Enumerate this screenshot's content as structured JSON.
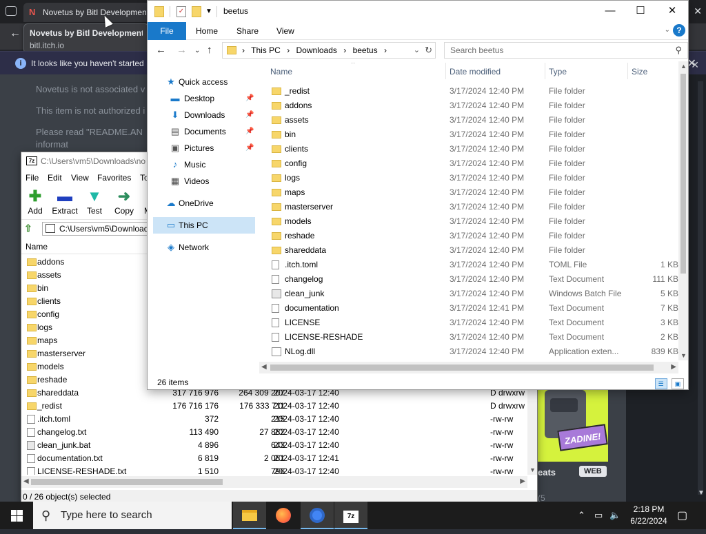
{
  "browser": {
    "tab_title": "Novetus by Bitl Development",
    "tab_favicon": "N",
    "tooltip_title": "Novetus by Bitl Development St",
    "tooltip_url": "bitl.itch.io",
    "info_text": "It looks like you haven't started I",
    "paragraphs": [
      "Novetus is not associated v",
      "This item is not authorized i",
      "Please read \"README.AN",
      "informat"
    ],
    "game_title": "eats",
    "web_badge": "WEB",
    "game_logo": "ZADINE!",
    "frag": "(5"
  },
  "sevenzip": {
    "title": "C:\\Users\\vm5\\Downloads\\no",
    "app_icon": "7z",
    "menu": [
      "File",
      "Edit",
      "View",
      "Favorites",
      "To"
    ],
    "tools": [
      {
        "label": "Add",
        "glyph": "✚",
        "color": "#2e9e2e"
      },
      {
        "label": "Extract",
        "glyph": "▬",
        "color": "#1f3fbf"
      },
      {
        "label": "Test",
        "glyph": "▼",
        "color": "#1fb8a6"
      },
      {
        "label": "Copy",
        "glyph": "➜",
        "color": "#2e8e5e"
      },
      {
        "label": "M",
        "glyph": "",
        "color": "#000"
      }
    ],
    "path": "C:\\Users\\vm5\\Download",
    "col_name": "Name",
    "rows": [
      {
        "name": "addons",
        "type": "folder",
        "size": "",
        "packed": "",
        "modified": "",
        "attr": ""
      },
      {
        "name": "assets",
        "type": "folder",
        "size": "",
        "packed": "",
        "modified": "",
        "attr": ""
      },
      {
        "name": "bin",
        "type": "folder",
        "size": "",
        "packed": "",
        "modified": "",
        "attr": ""
      },
      {
        "name": "clients",
        "type": "folder",
        "size": "",
        "packed": "",
        "modified": "",
        "attr": ""
      },
      {
        "name": "config",
        "type": "folder",
        "size": "",
        "packed": "",
        "modified": "",
        "attr": ""
      },
      {
        "name": "logs",
        "type": "folder",
        "size": "",
        "packed": "",
        "modified": "",
        "attr": ""
      },
      {
        "name": "maps",
        "type": "folder",
        "size": "",
        "packed": "",
        "modified": "",
        "attr": ""
      },
      {
        "name": "masterserver",
        "type": "folder",
        "size": "",
        "packed": "",
        "modified": "",
        "attr": ""
      },
      {
        "name": "models",
        "type": "folder",
        "size": "",
        "packed": "",
        "modified": "",
        "attr": ""
      },
      {
        "name": "reshade",
        "type": "folder",
        "size": "",
        "packed": "",
        "modified": "",
        "attr": ""
      },
      {
        "name": "shareddata",
        "type": "folder",
        "size": "317 716 976",
        "packed": "264 309 207",
        "modified": "2024-03-17 12:40",
        "attr": "D drwxrw"
      },
      {
        "name": "_redist",
        "type": "folder",
        "size": "176 716 176",
        "packed": "176 333 711",
        "modified": "2024-03-17 12:40",
        "attr": "D drwxrw"
      },
      {
        "name": ".itch.toml",
        "type": "file",
        "size": "372",
        "packed": "215",
        "modified": "2024-03-17 12:40",
        "attr": "-rw-rw"
      },
      {
        "name": "changelog.txt",
        "type": "file",
        "size": "113 490",
        "packed": "27 882",
        "modified": "2024-03-17 12:40",
        "attr": "-rw-rw"
      },
      {
        "name": "clean_junk.bat",
        "type": "bat",
        "size": "4 896",
        "packed": "643",
        "modified": "2024-03-17 12:40",
        "attr": "-rw-rw"
      },
      {
        "name": "documentation.txt",
        "type": "file",
        "size": "6 819",
        "packed": "2 081",
        "modified": "2024-03-17 12:41",
        "attr": "-rw-rw"
      },
      {
        "name": "LICENSE-RESHADE.txt",
        "type": "file",
        "size": "1 510",
        "packed": "796",
        "modified": "2024-03-17 12:40",
        "attr": "-rw-rw"
      }
    ],
    "status": "0 / 26 object(s) selected"
  },
  "explorer": {
    "title": "beetus",
    "ribbon_file": "File",
    "ribbon_tabs": [
      "Home",
      "Share",
      "View"
    ],
    "help": "?",
    "crumbs": [
      "This PC",
      "Downloads",
      "beetus"
    ],
    "search_placeholder": "Search beetus",
    "nav": [
      {
        "label": "Quick access",
        "icon": "★",
        "icon_color": "#1979ca",
        "pinned": false,
        "indent": 0,
        "selected": false
      },
      {
        "label": "Desktop",
        "icon": "▬",
        "icon_color": "#1979ca",
        "pinned": true,
        "indent": 1,
        "selected": false
      },
      {
        "label": "Downloads",
        "icon": "⬇",
        "icon_color": "#1979ca",
        "pinned": true,
        "indent": 1,
        "selected": false
      },
      {
        "label": "Documents",
        "icon": "▤",
        "icon_color": "#555",
        "pinned": true,
        "indent": 1,
        "selected": false
      },
      {
        "label": "Pictures",
        "icon": "▣",
        "icon_color": "#555",
        "pinned": true,
        "indent": 1,
        "selected": false
      },
      {
        "label": "Music",
        "icon": "♪",
        "icon_color": "#1979ca",
        "pinned": false,
        "indent": 1,
        "selected": false
      },
      {
        "label": "Videos",
        "icon": "▦",
        "icon_color": "#444",
        "pinned": false,
        "indent": 1,
        "selected": false
      },
      {
        "label": "OneDrive",
        "icon": "☁",
        "icon_color": "#1979ca",
        "pinned": false,
        "indent": 0,
        "selected": false
      },
      {
        "label": "This PC",
        "icon": "▭",
        "icon_color": "#1979ca",
        "pinned": false,
        "indent": 0,
        "selected": true
      },
      {
        "label": "Network",
        "icon": "◈",
        "icon_color": "#1979ca",
        "pinned": false,
        "indent": 0,
        "selected": false
      }
    ],
    "columns": [
      "Name",
      "Date modified",
      "Type",
      "Size"
    ],
    "files": [
      {
        "name": "_redist",
        "date": "3/17/2024 12:40 PM",
        "type": "File folder",
        "size": "",
        "icon": "folder"
      },
      {
        "name": "addons",
        "date": "3/17/2024 12:40 PM",
        "type": "File folder",
        "size": "",
        "icon": "folder"
      },
      {
        "name": "assets",
        "date": "3/17/2024 12:40 PM",
        "type": "File folder",
        "size": "",
        "icon": "folder"
      },
      {
        "name": "bin",
        "date": "3/17/2024 12:40 PM",
        "type": "File folder",
        "size": "",
        "icon": "folder"
      },
      {
        "name": "clients",
        "date": "3/17/2024 12:40 PM",
        "type": "File folder",
        "size": "",
        "icon": "folder"
      },
      {
        "name": "config",
        "date": "3/17/2024 12:40 PM",
        "type": "File folder",
        "size": "",
        "icon": "folder"
      },
      {
        "name": "logs",
        "date": "3/17/2024 12:40 PM",
        "type": "File folder",
        "size": "",
        "icon": "folder"
      },
      {
        "name": "maps",
        "date": "3/17/2024 12:40 PM",
        "type": "File folder",
        "size": "",
        "icon": "folder"
      },
      {
        "name": "masterserver",
        "date": "3/17/2024 12:40 PM",
        "type": "File folder",
        "size": "",
        "icon": "folder"
      },
      {
        "name": "models",
        "date": "3/17/2024 12:40 PM",
        "type": "File folder",
        "size": "",
        "icon": "folder"
      },
      {
        "name": "reshade",
        "date": "3/17/2024 12:40 PM",
        "type": "File folder",
        "size": "",
        "icon": "folder"
      },
      {
        "name": "shareddata",
        "date": "3/17/2024 12:40 PM",
        "type": "File folder",
        "size": "",
        "icon": "folder"
      },
      {
        "name": ".itch.toml",
        "date": "3/17/2024 12:40 PM",
        "type": "TOML File",
        "size": "1 KB",
        "icon": "file"
      },
      {
        "name": "changelog",
        "date": "3/17/2024 12:40 PM",
        "type": "Text Document",
        "size": "111 KB",
        "icon": "file"
      },
      {
        "name": "clean_junk",
        "date": "3/17/2024 12:40 PM",
        "type": "Windows Batch File",
        "size": "5 KB",
        "icon": "bat"
      },
      {
        "name": "documentation",
        "date": "3/17/2024 12:41 PM",
        "type": "Text Document",
        "size": "7 KB",
        "icon": "file"
      },
      {
        "name": "LICENSE",
        "date": "3/17/2024 12:40 PM",
        "type": "Text Document",
        "size": "3 KB",
        "icon": "file"
      },
      {
        "name": "LICENSE-RESHADE",
        "date": "3/17/2024 12:40 PM",
        "type": "Text Document",
        "size": "2 KB",
        "icon": "file"
      },
      {
        "name": "NLog.dll",
        "date": "3/17/2024 12:40 PM",
        "type": "Application exten...",
        "size": "839 KB",
        "icon": "app"
      }
    ],
    "status": "26 items"
  },
  "taskbar": {
    "search_placeholder": "Type here to search",
    "time": "2:18 PM",
    "date": "6/22/2024"
  }
}
